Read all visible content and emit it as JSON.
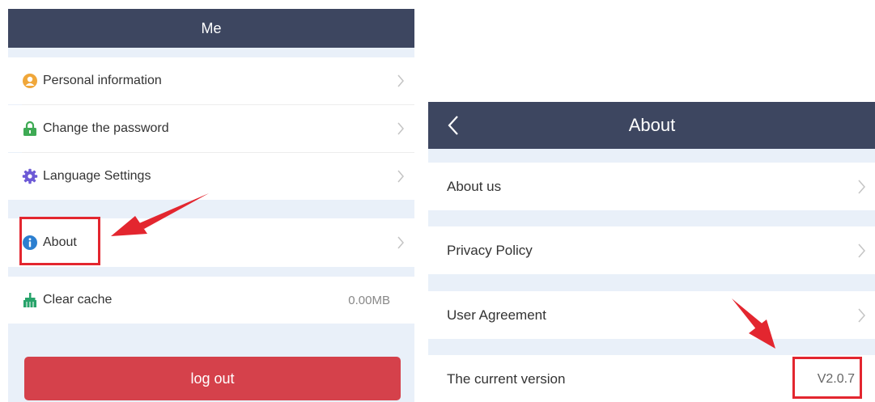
{
  "me_screen": {
    "title": "Me",
    "items": [
      {
        "label": "Personal information",
        "icon": "person-icon",
        "color": "#f0a73a"
      },
      {
        "label": "Change the password",
        "icon": "lock-icon",
        "color": "#3eaa54"
      },
      {
        "label": "Language Settings",
        "icon": "gear-icon",
        "color": "#6d5ad6"
      },
      {
        "label": "About",
        "icon": "info-icon",
        "color": "#2c7fd0"
      },
      {
        "label": "Clear cache",
        "icon": "broom-icon",
        "color": "#27a36a",
        "value": "0.00MB"
      }
    ],
    "logout_label": "log out"
  },
  "about_screen": {
    "title": "About",
    "items": [
      {
        "label": "About us"
      },
      {
        "label": "Privacy Policy"
      },
      {
        "label": "User Agreement"
      },
      {
        "label": "The current version",
        "value": "V2.0.7"
      }
    ]
  },
  "colors": {
    "navbar": "#3d4660",
    "background": "#e9f0f9",
    "logout_button": "#d5414b",
    "annotation": "#e3262f"
  }
}
